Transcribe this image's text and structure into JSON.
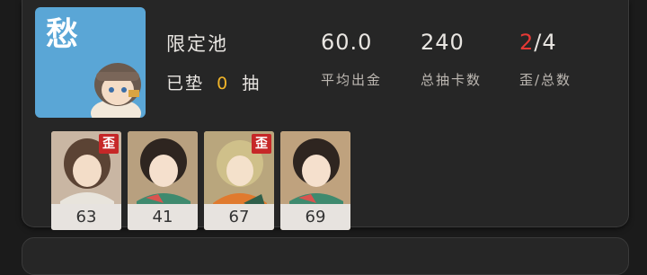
{
  "pool": {
    "avatar_char": "愁",
    "name": "限定池",
    "pity_prefix": "已垫",
    "pity_count": "0",
    "pity_suffix": "抽"
  },
  "stats": [
    {
      "value": "60.0",
      "label": "平均出金"
    },
    {
      "value": "240",
      "label": "总抽卡数"
    },
    {
      "value_red": "2",
      "value_rest": "/4",
      "label": "歪/总数"
    }
  ],
  "pulls": [
    {
      "count": "63",
      "tag": "歪",
      "off_banner": true
    },
    {
      "count": "41",
      "tag": "",
      "off_banner": false
    },
    {
      "count": "67",
      "tag": "歪",
      "off_banner": true
    },
    {
      "count": "69",
      "tag": "",
      "off_banner": false
    }
  ],
  "colors": {
    "accent_yellow": "#f0b429",
    "off_banner_red": "#c62828",
    "avatar_blue": "#5aa6d6"
  }
}
